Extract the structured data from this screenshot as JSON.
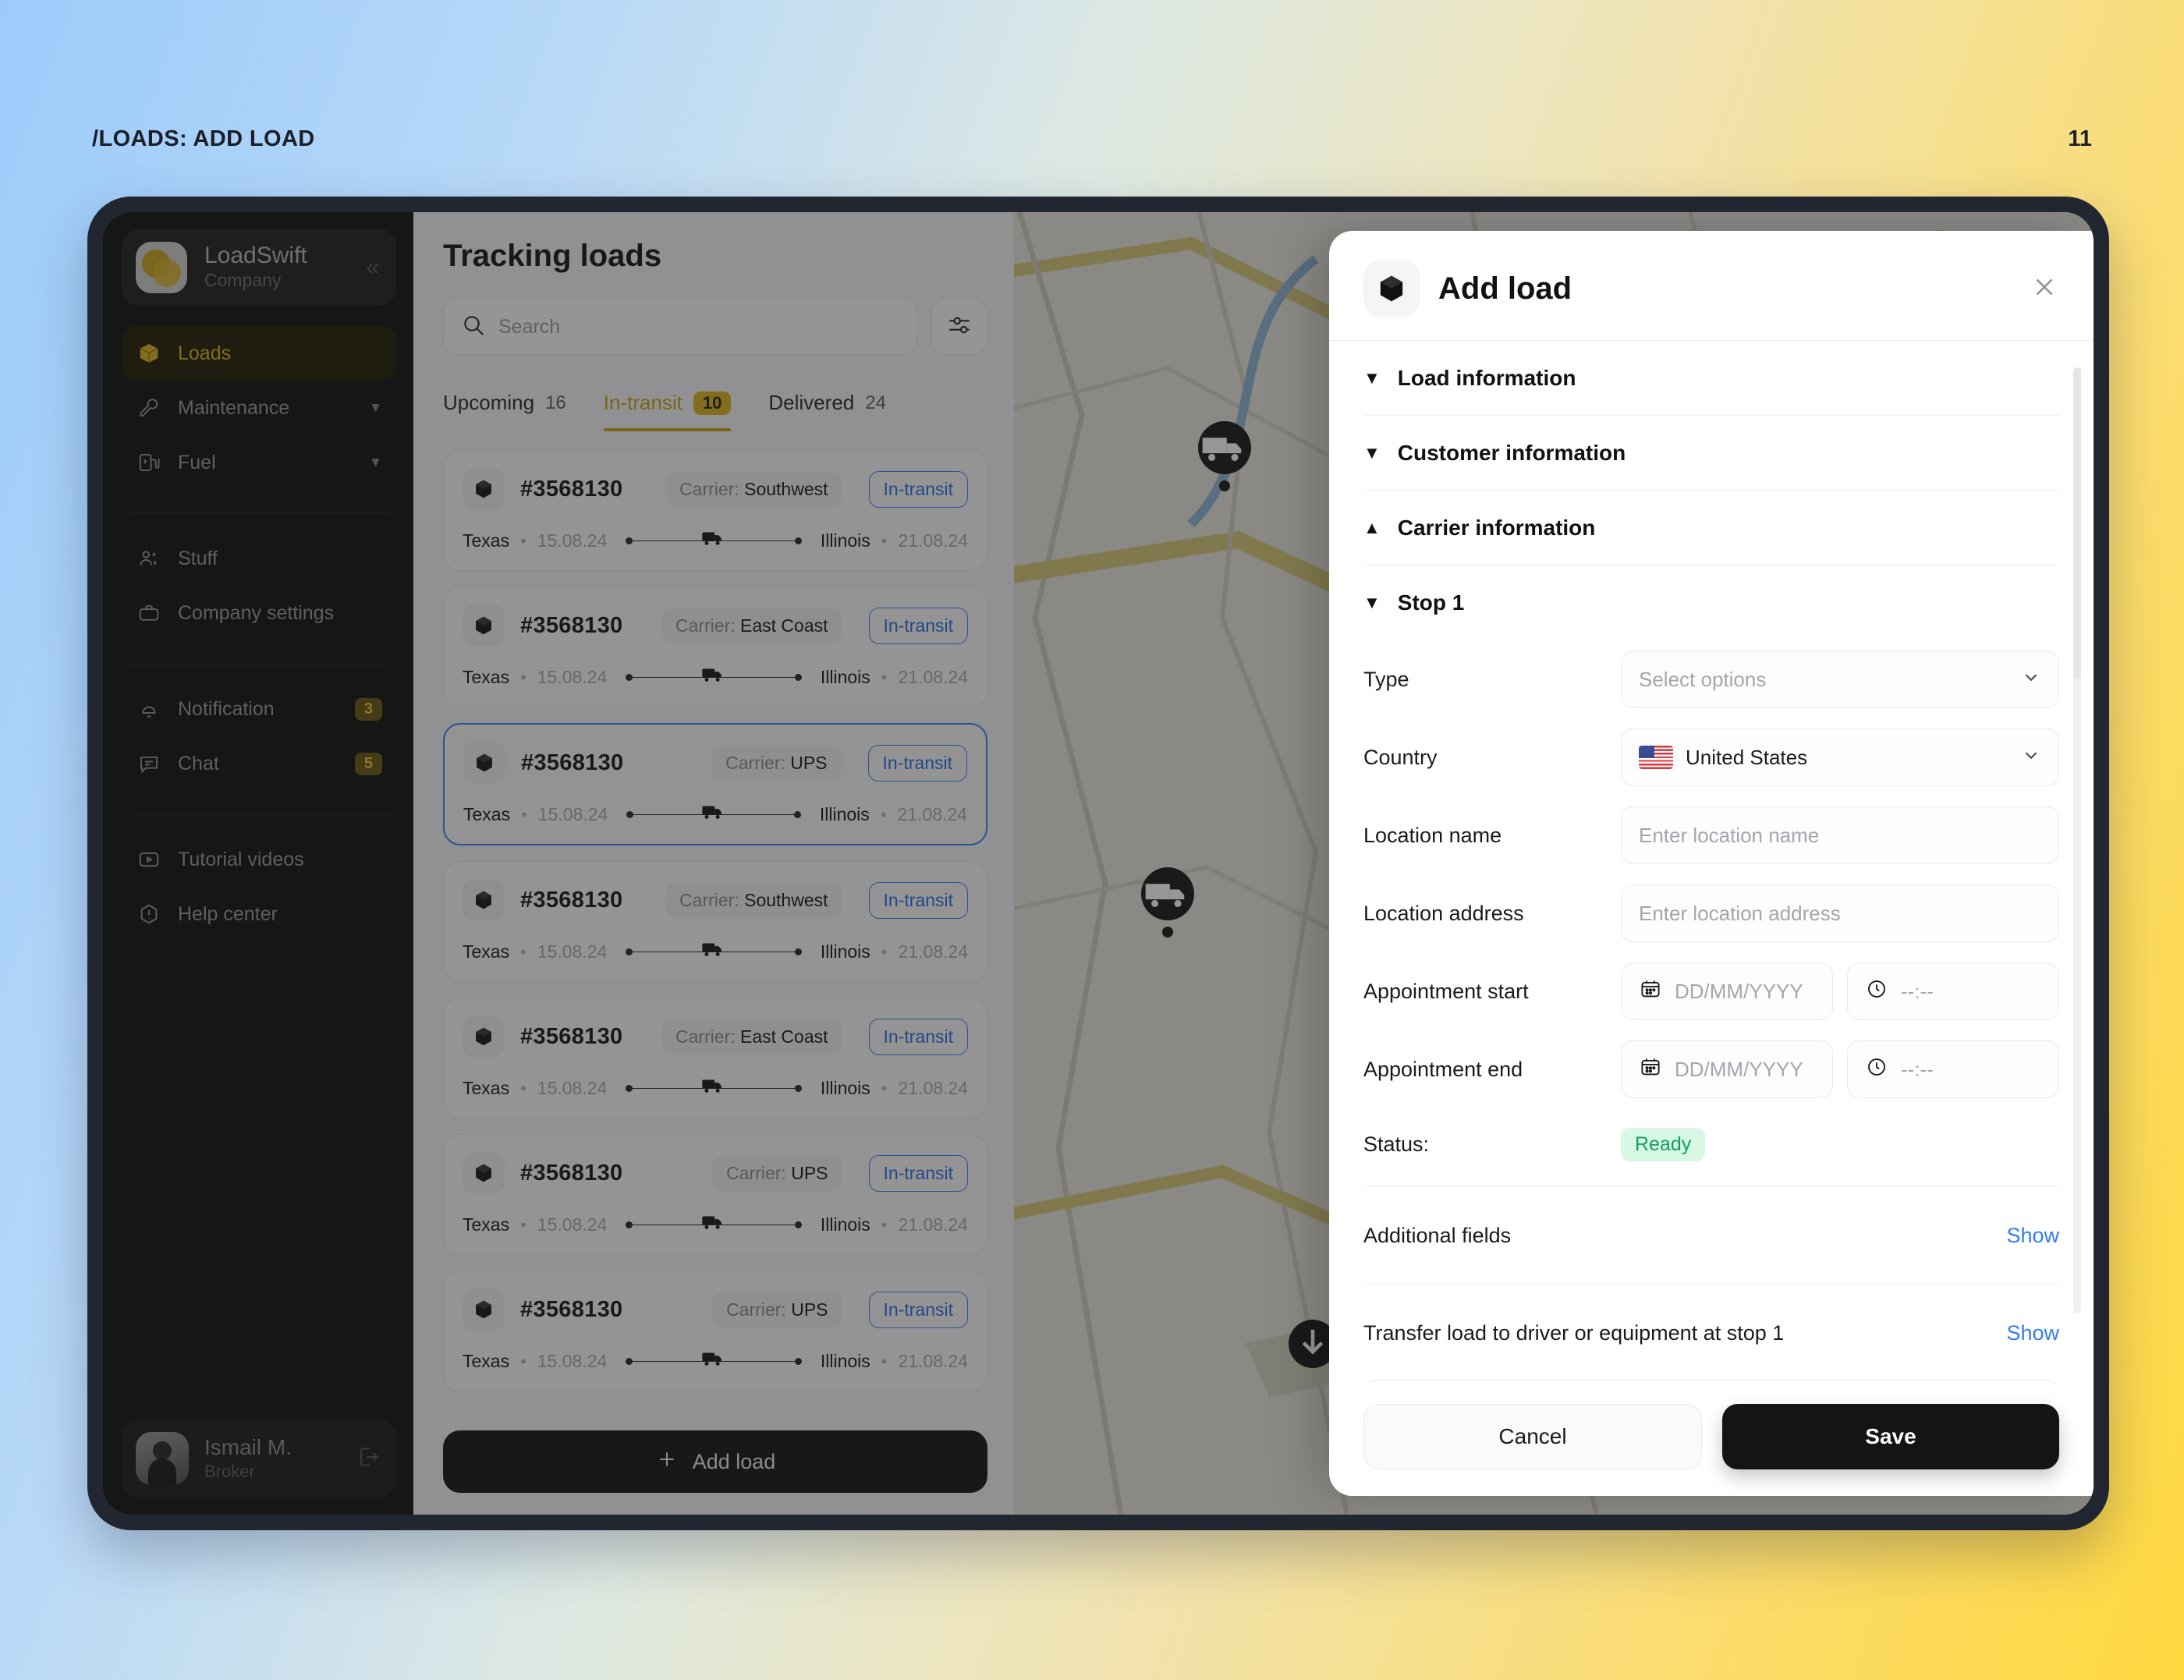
{
  "caption": "/LOADS: ADD LOAD",
  "page_number": "11",
  "sidebar": {
    "brand": {
      "name": "LoadSwift",
      "subtitle": "Company",
      "collapse_icon": "chevrons-left-icon"
    },
    "groups": [
      {
        "items": [
          {
            "label": "Loads",
            "icon": "box-icon",
            "active": true
          },
          {
            "label": "Maintenance",
            "icon": "wrench-icon",
            "chevron": true
          },
          {
            "label": "Fuel",
            "icon": "fuel-icon",
            "chevron": true
          }
        ]
      },
      {
        "items": [
          {
            "label": "Stuff",
            "icon": "users-icon"
          },
          {
            "label": "Company settings",
            "icon": "briefcase-icon"
          }
        ]
      },
      {
        "items": [
          {
            "label": "Notification",
            "icon": "bell-icon",
            "badge": "3"
          },
          {
            "label": "Chat",
            "icon": "chat-icon",
            "badge": "5"
          }
        ]
      },
      {
        "items": [
          {
            "label": "Tutorial videos",
            "icon": "video-icon"
          },
          {
            "label": "Help center",
            "icon": "help-icon"
          }
        ]
      }
    ],
    "user": {
      "name": "Ismail M.",
      "role": "Broker",
      "logout_icon": "logout-icon"
    }
  },
  "loads_panel": {
    "title": "Tracking loads",
    "search_placeholder": "Search",
    "search_value": "",
    "filter_icon": "sliders-icon",
    "tabs": [
      {
        "label": "Upcoming",
        "count": "16",
        "active": false
      },
      {
        "label": "In-transit",
        "count": "10",
        "active": true
      },
      {
        "label": "Delivered",
        "count": "24",
        "active": false
      }
    ],
    "cards": [
      {
        "id": "#3568130",
        "carrier_label": "Carrier:",
        "carrier": "Southwest",
        "status": "In-transit",
        "origin": "Texas",
        "origin_date": "15.08.24",
        "dest": "Illinois",
        "dest_date": "21.08.24",
        "selected": false
      },
      {
        "id": "#3568130",
        "carrier_label": "Carrier:",
        "carrier": "East Coast",
        "status": "In-transit",
        "origin": "Texas",
        "origin_date": "15.08.24",
        "dest": "Illinois",
        "dest_date": "21.08.24",
        "selected": false
      },
      {
        "id": "#3568130",
        "carrier_label": "Carrier:",
        "carrier": "UPS",
        "status": "In-transit",
        "origin": "Texas",
        "origin_date": "15.08.24",
        "dest": "Illinois",
        "dest_date": "21.08.24",
        "selected": true
      },
      {
        "id": "#3568130",
        "carrier_label": "Carrier:",
        "carrier": "Southwest",
        "status": "In-transit",
        "origin": "Texas",
        "origin_date": "15.08.24",
        "dest": "Illinois",
        "dest_date": "21.08.24",
        "selected": false
      },
      {
        "id": "#3568130",
        "carrier_label": "Carrier:",
        "carrier": "East Coast",
        "status": "In-transit",
        "origin": "Texas",
        "origin_date": "15.08.24",
        "dest": "Illinois",
        "dest_date": "21.08.24",
        "selected": false
      },
      {
        "id": "#3568130",
        "carrier_label": "Carrier:",
        "carrier": "UPS",
        "status": "In-transit",
        "origin": "Texas",
        "origin_date": "15.08.24",
        "dest": "Illinois",
        "dest_date": "21.08.24",
        "selected": false
      },
      {
        "id": "#3568130",
        "carrier_label": "Carrier:",
        "carrier": "UPS",
        "status": "In-transit",
        "origin": "Texas",
        "origin_date": "15.08.24",
        "dest": "Illinois",
        "dest_date": "21.08.24",
        "selected": false
      }
    ],
    "add_button": "Add load"
  },
  "map": {
    "truck_marker_icon": "truck-marker-icon",
    "download_icon": "download-icon"
  },
  "modal": {
    "title": "Add load",
    "icon": "box-icon",
    "close_icon": "close-icon",
    "sections": [
      {
        "label": "Load information",
        "expanded": false
      },
      {
        "label": "Customer information",
        "expanded": false
      },
      {
        "label": "Carrier information",
        "expanded": true
      },
      {
        "label": "Stop 1",
        "expanded": false
      }
    ],
    "fields": {
      "type": {
        "label": "Type",
        "placeholder": "Select options",
        "value": ""
      },
      "country": {
        "label": "Country",
        "value": "United States",
        "flag": "us-flag-icon"
      },
      "location_name": {
        "label": "Location name",
        "placeholder": "Enter location name",
        "value": ""
      },
      "location_address": {
        "label": "Location address",
        "placeholder": "Enter location address",
        "value": ""
      },
      "appointment_start": {
        "label": "Appointment start",
        "date_placeholder": "DD/MM/YYYY",
        "time_placeholder": "--:--"
      },
      "appointment_end": {
        "label": "Appointment end",
        "date_placeholder": "DD/MM/YYYY",
        "time_placeholder": "--:--"
      },
      "status": {
        "label": "Status:",
        "value": "Ready"
      }
    },
    "additional_fields": {
      "label": "Additional fields",
      "action": "Show"
    },
    "transfer_load": {
      "label": "Transfer load to driver or equipment at stop 1",
      "action": "Show"
    },
    "cancel_label": "Cancel",
    "save_label": "Save"
  },
  "colors": {
    "accent_yellow": "#c9a61c",
    "accent_blue": "#2f7cf6",
    "status_green": "#13a05c",
    "dark": "#141414"
  }
}
